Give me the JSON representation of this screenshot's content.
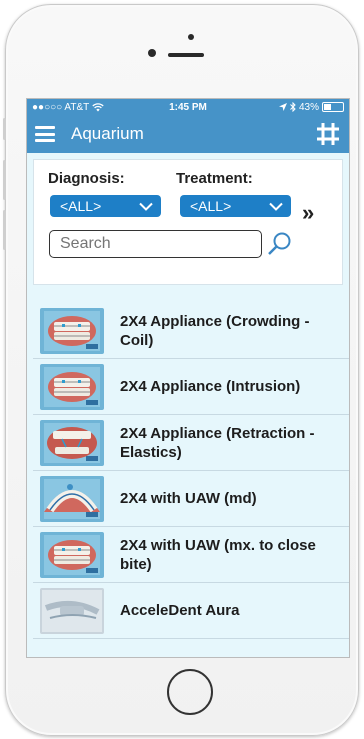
{
  "status_bar": {
    "carrier": "●●○○○ AT&T",
    "time": "1:45 PM",
    "battery": "43%",
    "battery_level": 0.43
  },
  "nav": {
    "title": "Aquarium"
  },
  "filters": {
    "diagnosis_label": "Diagnosis:",
    "treatment_label": "Treatment:",
    "diagnosis_value": "<ALL>",
    "treatment_value": "<ALL>",
    "more_arrow": "»",
    "search_placeholder": "Search"
  },
  "items": [
    {
      "label": "2X4 Appliance (Crowding - Coil)",
      "thumb": "braces-front"
    },
    {
      "label": "2X4 Appliance (Intrusion)",
      "thumb": "braces-front"
    },
    {
      "label": "2X4 Appliance (Retraction - Elastics)",
      "thumb": "braces-open"
    },
    {
      "label": "2X4 with UAW (md)",
      "thumb": "arch-top"
    },
    {
      "label": "2X4 with UAW (mx. to close bite)",
      "thumb": "braces-front"
    },
    {
      "label": "AcceleDent Aura",
      "thumb": "device"
    }
  ],
  "colors": {
    "accent": "#4693c8",
    "dropdown": "#1e7fc7",
    "list_bg": "#e6f7fc"
  }
}
